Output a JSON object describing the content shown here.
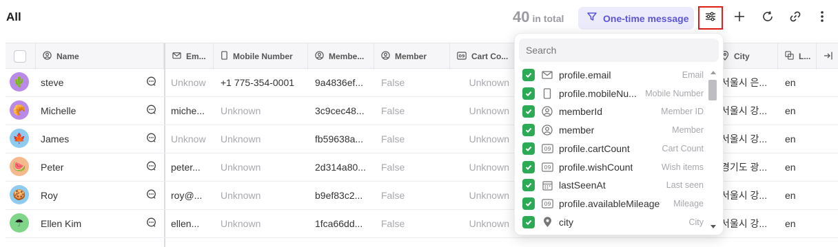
{
  "header": {
    "title": "All",
    "count": "40",
    "count_label": "in total",
    "filter_label": "One-time message",
    "accent": "#5a55d8"
  },
  "columns": [
    {
      "label": "Name",
      "icon": "user-circle-icon"
    },
    {
      "label": "Em...",
      "icon": "mail-icon"
    },
    {
      "label": "Mobile Number",
      "icon": "phone-icon"
    },
    {
      "label": "Membe...",
      "icon": "user-circle-icon"
    },
    {
      "label": "Member",
      "icon": "user-circle-icon"
    },
    {
      "label": "Cart Co...",
      "icon": "number-icon"
    },
    {
      "label": "City",
      "icon": "pin-icon"
    },
    {
      "label": "L...",
      "icon": "language-icon"
    }
  ],
  "rows": [
    {
      "name": "steve",
      "avatar": "🌵",
      "avatar_bg": "#b98ae8",
      "email": "Unknow",
      "mobile": "+1 775-354-0001",
      "member_id": "9a4836ef...",
      "member": "False",
      "cart": "Unknown",
      "city": "서울시 은...",
      "lang": "en"
    },
    {
      "name": "Michelle",
      "avatar": "🥐",
      "avatar_bg": "#b98ae8",
      "email": "miche...",
      "mobile": "Unknown",
      "member_id": "3c9cec48...",
      "member": "False",
      "cart": "Unknown",
      "city": "서울시 강...",
      "lang": "en"
    },
    {
      "name": "James",
      "avatar": "🍁",
      "avatar_bg": "#8ecbf0",
      "email": "Unknow",
      "mobile": "Unknown",
      "member_id": "fb59638a...",
      "member": "False",
      "cart": "Unknown",
      "city": "서울시 강...",
      "lang": "en"
    },
    {
      "name": "Peter",
      "avatar": "🍉",
      "avatar_bg": "#f5b98e",
      "email": "peter...",
      "mobile": "Unknown",
      "member_id": "2d314a80...",
      "member": "False",
      "cart": "Unknown",
      "city": "경기도 광...",
      "lang": "en"
    },
    {
      "name": "Roy",
      "avatar": "🍪",
      "avatar_bg": "#8ecbf0",
      "email": "roy@...",
      "mobile": "Unknown",
      "member_id": "b9ef83c2...",
      "member": "False",
      "cart": "Unknown",
      "city": "서울시 강...",
      "lang": "en"
    },
    {
      "name": "Ellen Kim",
      "avatar": "☂",
      "avatar_bg": "#7fd68a",
      "email": "ellen...",
      "mobile": "Unknown",
      "member_id": "1fca66dd...",
      "member": "False",
      "cart": "Unknown",
      "city": "서울시 강...",
      "lang": "en"
    }
  ],
  "dropdown": {
    "search_placeholder": "Search",
    "options": [
      {
        "key": "profile.email",
        "label": "Email",
        "icon": "mail-icon"
      },
      {
        "key": "profile.mobileNu...",
        "label": "Mobile Number",
        "icon": "phone-icon"
      },
      {
        "key": "memberId",
        "label": "Member ID",
        "icon": "user-circle-icon"
      },
      {
        "key": "member",
        "label": "Member",
        "icon": "user-circle-icon"
      },
      {
        "key": "profile.cartCount",
        "label": "Cart Count",
        "icon": "number-icon"
      },
      {
        "key": "profile.wishCount",
        "label": "Wish items",
        "icon": "number-icon"
      },
      {
        "key": "lastSeenAt",
        "label": "Last seen",
        "icon": "calendar-icon"
      },
      {
        "key": "profile.availableMileage",
        "label": "Mileage",
        "icon": "number-icon"
      },
      {
        "key": "city",
        "label": "City",
        "icon": "pin-icon"
      }
    ],
    "check_color": "#2daa55"
  }
}
